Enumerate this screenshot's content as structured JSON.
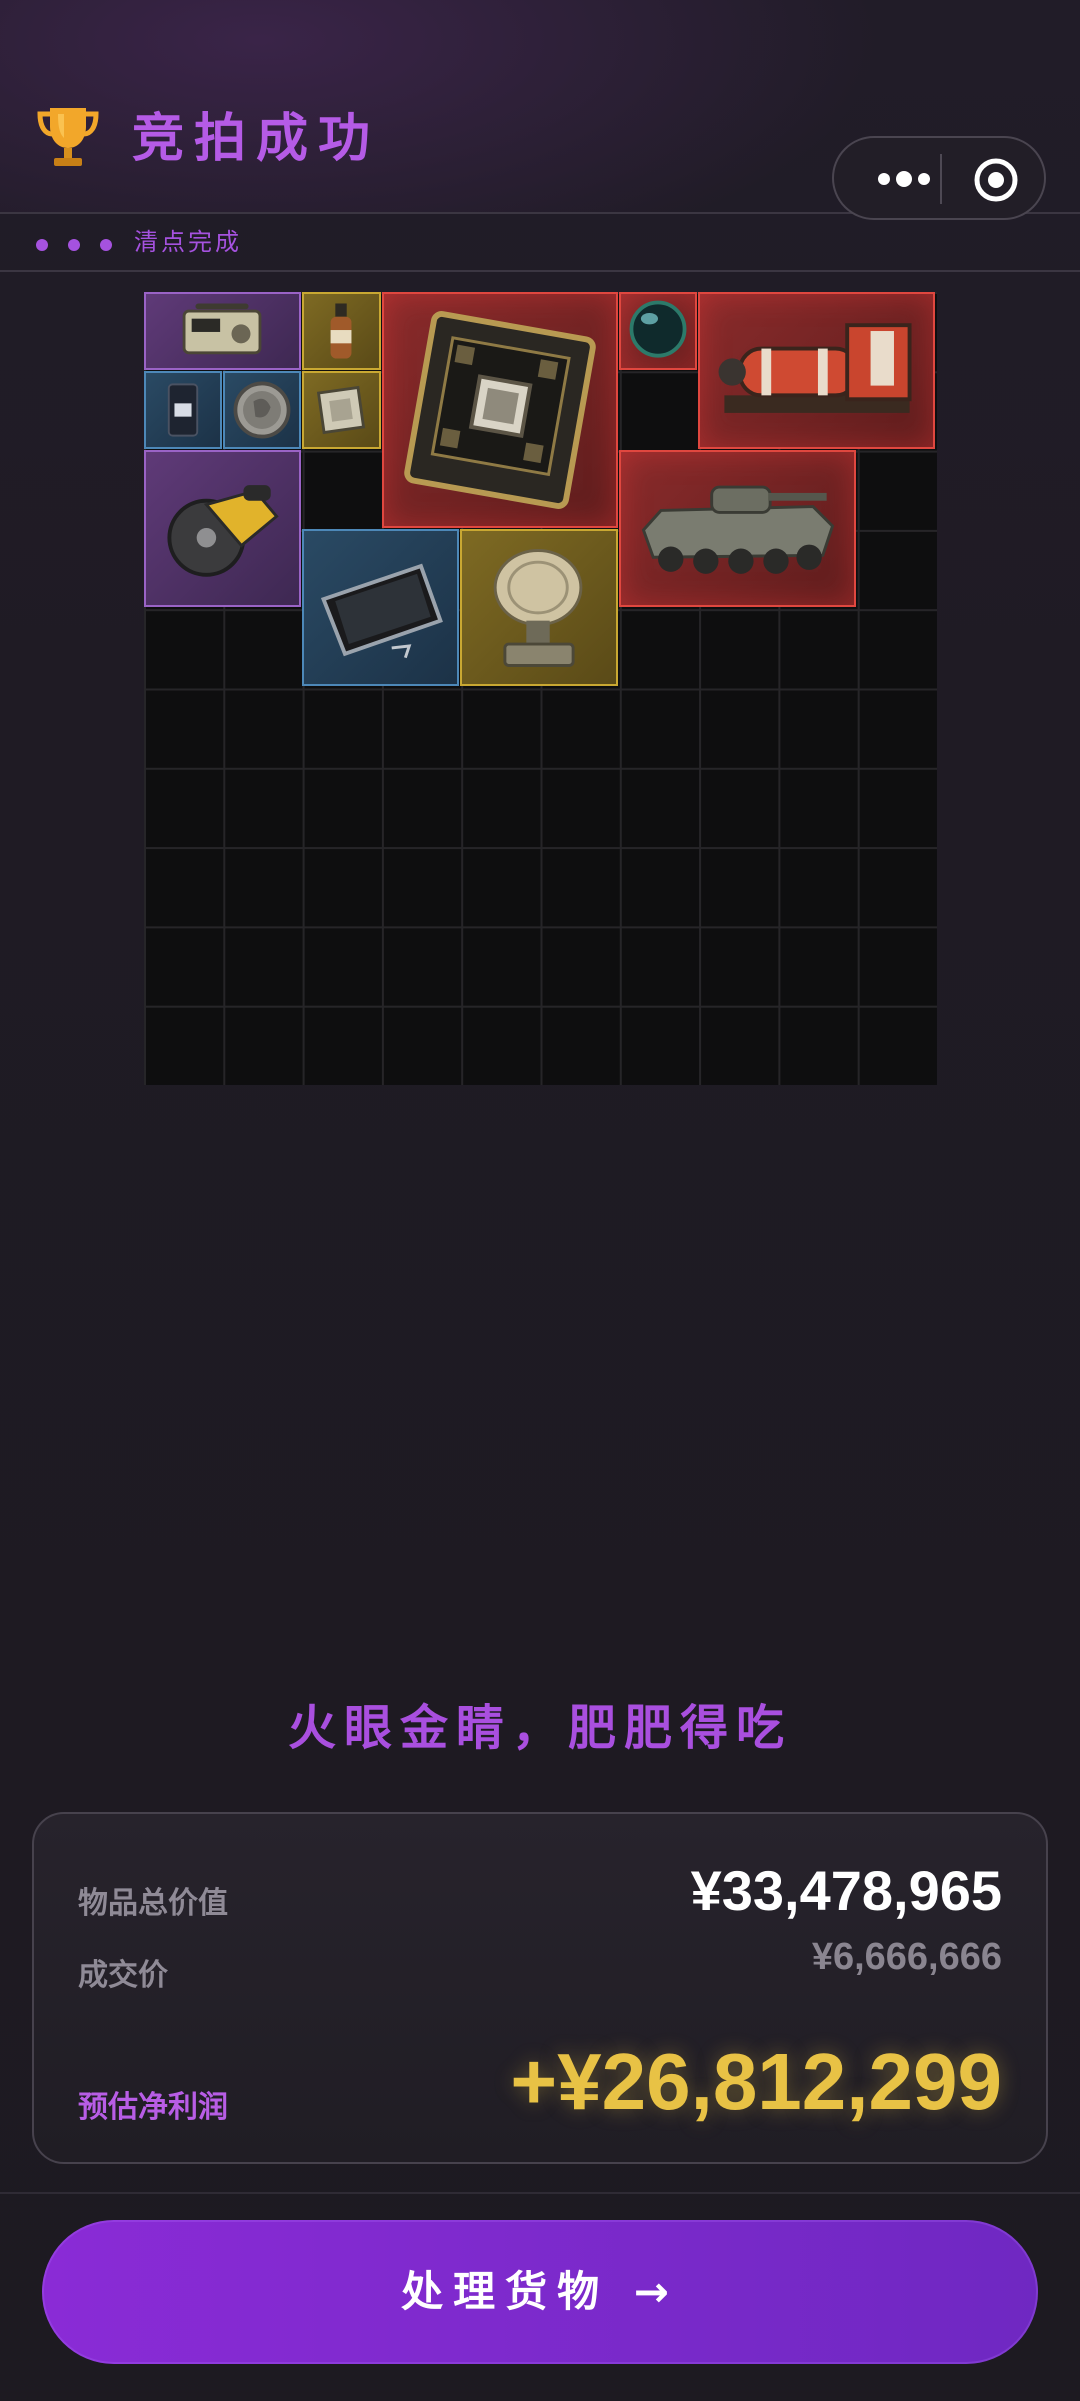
{
  "header": {
    "title": "竞拍成功",
    "subtitle": "清点完成"
  },
  "inventory": {
    "items": [
      {
        "name": "radio",
        "rarity": "purple"
      },
      {
        "name": "bottle",
        "rarity": "gold"
      },
      {
        "name": "circuit-board",
        "rarity": "red"
      },
      {
        "name": "orb",
        "rarity": "red"
      },
      {
        "name": "fuel-generator",
        "rarity": "red"
      },
      {
        "name": "coffee-bag",
        "rarity": "blue"
      },
      {
        "name": "coin",
        "rarity": "blue"
      },
      {
        "name": "cpu-chip",
        "rarity": "gold"
      },
      {
        "name": "circular-saw",
        "rarity": "purple"
      },
      {
        "name": "armored-vehicle",
        "rarity": "red"
      },
      {
        "name": "tablet",
        "rarity": "blue"
      },
      {
        "name": "radar-dish",
        "rarity": "gold"
      }
    ],
    "colors": {
      "purple": "#9a63c6",
      "gold": "#c9a832",
      "blue": "#4d88b8",
      "red": "#e0473f"
    }
  },
  "slogan": "火眼金睛，肥肥得吃",
  "summary": {
    "total_label": "物品总价值",
    "total_value": "¥33,478,965",
    "deal_label": "成交价",
    "deal_value": "¥6,666,666",
    "profit_label": "预估净利润",
    "profit_value": "+¥26,812,299"
  },
  "cta": {
    "label": "处理货物 →"
  },
  "colors": {
    "accent": "#a552df",
    "profit": "#e8c245",
    "background": "#1f1b24"
  }
}
